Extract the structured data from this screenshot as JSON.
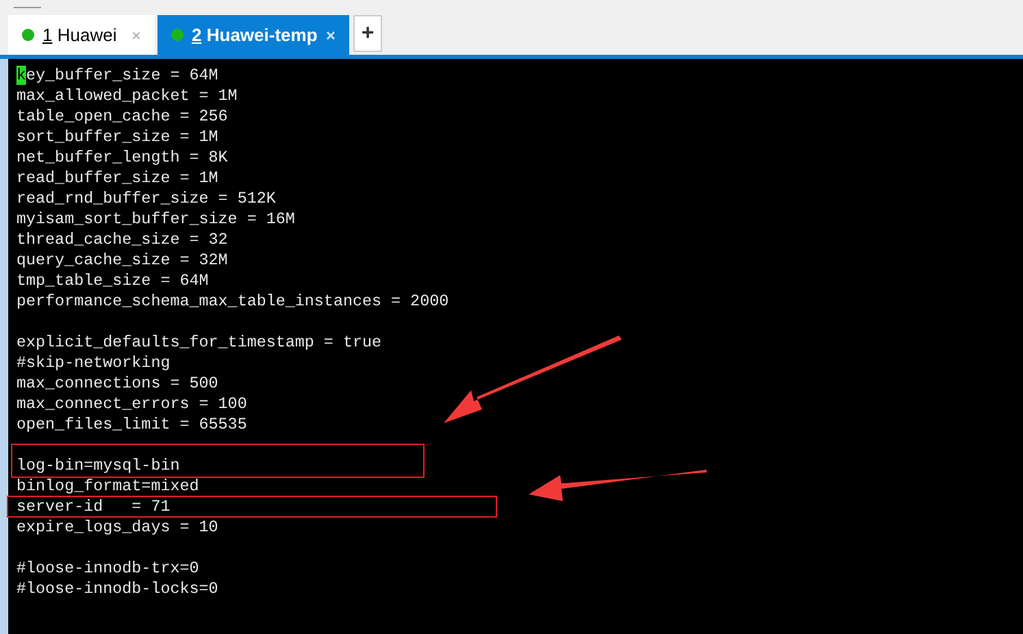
{
  "tabs": [
    {
      "number": "1",
      "label": "Huawei",
      "selected": false,
      "close": "×"
    },
    {
      "number": "2",
      "label": "Huawei-temp",
      "selected": true,
      "close": "×"
    }
  ],
  "new_tab": "+",
  "terminal": {
    "lines": [
      {
        "kind": "text",
        "text": "key_buffer_size = 64M",
        "cursor": true
      },
      {
        "kind": "text",
        "text": "max_allowed_packet = 1M"
      },
      {
        "kind": "text",
        "text": "table_open_cache = 256"
      },
      {
        "kind": "text",
        "text": "sort_buffer_size = 1M"
      },
      {
        "kind": "text",
        "text": "net_buffer_length = 8K"
      },
      {
        "kind": "text",
        "text": "read_buffer_size = 1M"
      },
      {
        "kind": "text",
        "text": "read_rnd_buffer_size = 512K"
      },
      {
        "kind": "text",
        "text": "myisam_sort_buffer_size = 16M"
      },
      {
        "kind": "text",
        "text": "thread_cache_size = 32"
      },
      {
        "kind": "text",
        "text": "query_cache_size = 32M"
      },
      {
        "kind": "text",
        "text": "tmp_table_size = 64M"
      },
      {
        "kind": "text",
        "text": "performance_schema_max_table_instances = 2000"
      },
      {
        "kind": "blank"
      },
      {
        "kind": "text",
        "text": "explicit_defaults_for_timestamp = true"
      },
      {
        "kind": "text",
        "text": "#skip-networking"
      },
      {
        "kind": "text",
        "text": "max_connections = 500"
      },
      {
        "kind": "text",
        "text": "max_connect_errors = 100"
      },
      {
        "kind": "text",
        "text": "open_files_limit = 65535"
      },
      {
        "kind": "blank"
      },
      {
        "kind": "boxed",
        "text": "log-bin=mysql-bin"
      },
      {
        "kind": "text",
        "text": "binlog_format=mixed"
      },
      {
        "kind": "boxedwide",
        "text": "server-id   = 71"
      },
      {
        "kind": "text",
        "text": "expire_logs_days = 10"
      },
      {
        "kind": "blank"
      },
      {
        "kind": "text",
        "text": "#loose-innodb-trx=0"
      },
      {
        "kind": "text",
        "text": "#loose-innodb-locks=0"
      }
    ]
  }
}
